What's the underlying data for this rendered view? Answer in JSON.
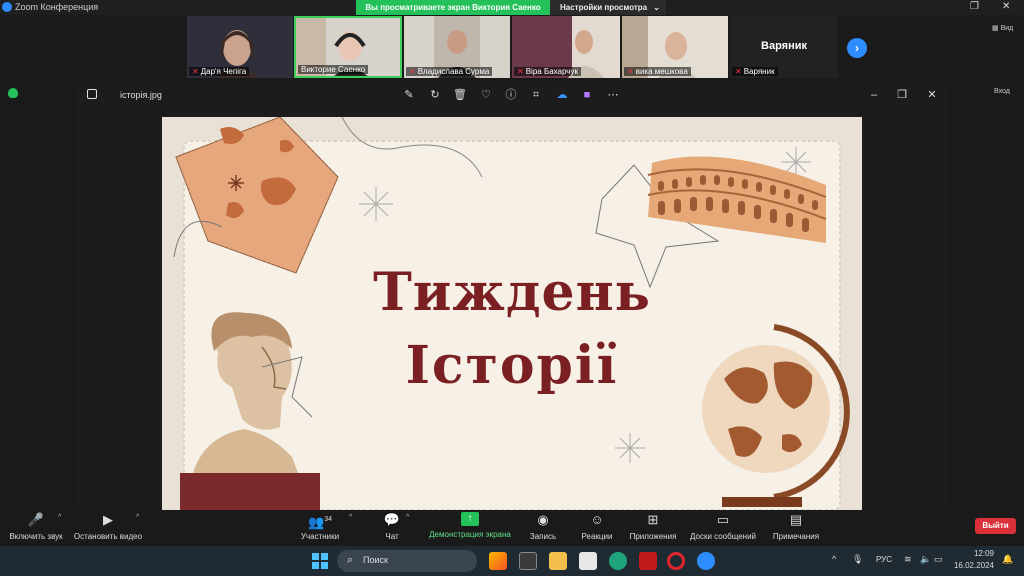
{
  "app": {
    "title": "Zoom Конференция"
  },
  "banner": {
    "sharing_text": "Вы просматриваете экран Виктория Саенко",
    "view_settings": "Настройки просмотра"
  },
  "participants": [
    {
      "name": "Дар'я Чепіга"
    },
    {
      "name": "Викторие Саенко"
    },
    {
      "name": "Владислава Сурма"
    },
    {
      "name": "Віра Бахарчук"
    },
    {
      "name": "вика мешкова"
    },
    {
      "name": "Варяник",
      "display": "Варяник"
    }
  ],
  "side_labels": {
    "view_top": "Вид",
    "view_mid": "Вход"
  },
  "viewer": {
    "file_name": "історія.jpg"
  },
  "poster": {
    "line1": "Тиждень",
    "line2": "Історії"
  },
  "toolbar": {
    "mute": "Включить звук",
    "video": "Остановить видео",
    "participants": "Участники",
    "participants_count": "34",
    "chat": "Чат",
    "share": "Демонстрация экрана",
    "record": "Запись",
    "reactions": "Реакции",
    "apps": "Приложения",
    "whiteboards": "Доски сообщений",
    "notes": "Примечания",
    "leave": "Выйти"
  },
  "taskbar": {
    "search_placeholder": "Поиск",
    "lang": "РУС",
    "time": "12:09",
    "date": "16.02.2024"
  },
  "colors": {
    "accent": "#2d8cff",
    "share_green": "#24c05a",
    "leave_red": "#d9303a",
    "poster_title": "#7a1f22"
  }
}
